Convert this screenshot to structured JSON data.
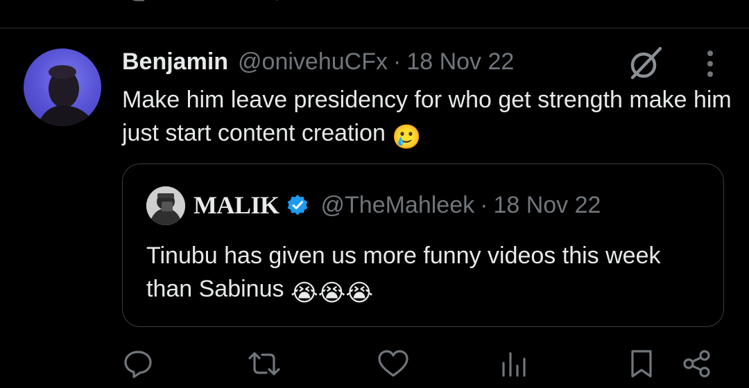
{
  "colors": {
    "background": "#000000",
    "text_primary": "#e7e9ea",
    "text_secondary": "#71767b",
    "border": "#2f3336",
    "verified_blue": "#1d9bf0"
  },
  "tweet": {
    "author": {
      "name": "Benjamin",
      "handle": "@onivehuCFx"
    },
    "separator": "·",
    "date": "18 Nov 22",
    "text": "Make him leave presidency for who get strength make him just start content creation",
    "emoji": "🥲",
    "header_icons": [
      "grok-icon",
      "more-icon"
    ],
    "quoted": {
      "author": {
        "name": "MALIK",
        "handle": "@TheMahleek",
        "verified": true
      },
      "separator": "·",
      "date": "18 Nov 22",
      "text": "Tinubu has given us more funny videos this week than Sabinus",
      "emojis": "😭😭😭"
    },
    "actions": [
      "reply-icon",
      "retweet-icon",
      "like-icon",
      "views-icon",
      "bookmark-icon",
      "share-icon"
    ]
  }
}
